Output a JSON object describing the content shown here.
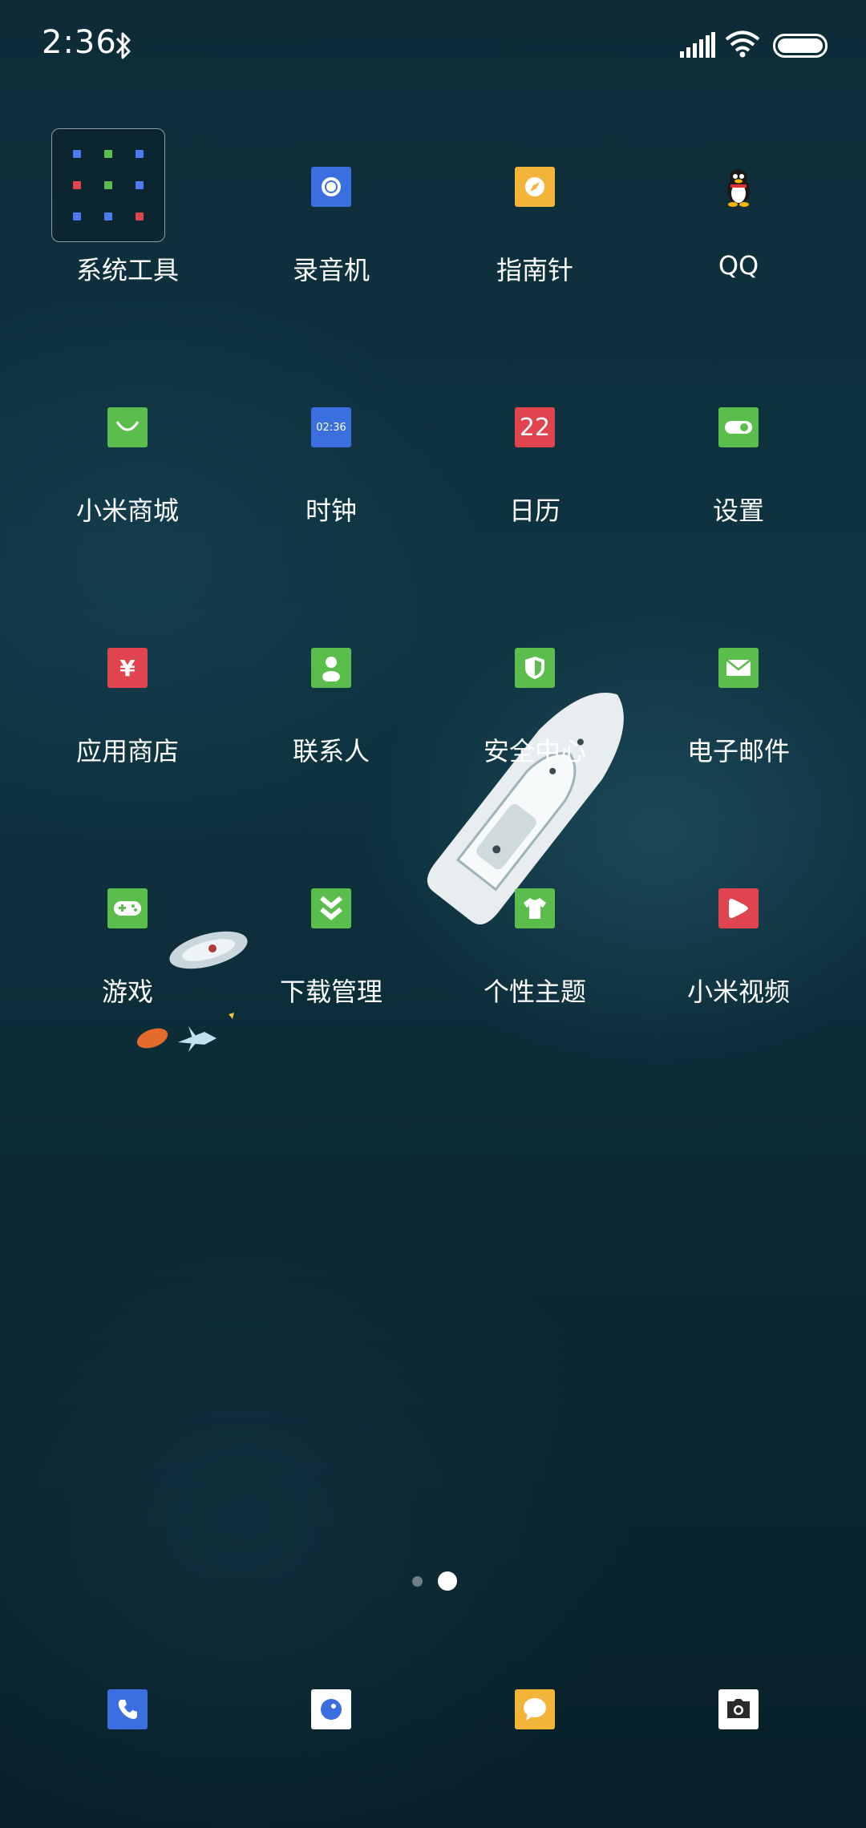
{
  "status": {
    "time": "2:36",
    "icons": [
      "bluetooth-icon",
      "signal-icon",
      "wifi-icon",
      "battery-icon"
    ]
  },
  "apps": [
    {
      "label": "系统工具",
      "icon": "folder-icon",
      "color": "#1a2d33"
    },
    {
      "label": "录音机",
      "icon": "recorder-icon",
      "color": "#3b6fe0"
    },
    {
      "label": "指南针",
      "icon": "compass-icon",
      "color": "#f3b43a"
    },
    {
      "label": "QQ",
      "icon": "qq-penguin-icon",
      "color": "#000000"
    },
    {
      "label": "小米商城",
      "icon": "shopping-bag-icon",
      "color": "#5bbd4c"
    },
    {
      "label": "时钟",
      "icon": "clock-icon",
      "color": "#3b6fe0",
      "tile_text": "02:36"
    },
    {
      "label": "日历",
      "icon": "calendar-icon",
      "color": "#e0454f",
      "tile_text": "22"
    },
    {
      "label": "设置",
      "icon": "settings-toggle-icon",
      "color": "#5bbd4c"
    },
    {
      "label": "应用商店",
      "icon": "yuan-icon",
      "color": "#e0454f",
      "tile_text": "¥"
    },
    {
      "label": "联系人",
      "icon": "person-icon",
      "color": "#5bbd4c"
    },
    {
      "label": "安全中心",
      "icon": "shield-icon",
      "color": "#5bbd4c"
    },
    {
      "label": "电子邮件",
      "icon": "envelope-icon",
      "color": "#5bbd4c"
    },
    {
      "label": "游戏",
      "icon": "gamepad-icon",
      "color": "#5bbd4c"
    },
    {
      "label": "下载管理",
      "icon": "download-icon",
      "color": "#5bbd4c"
    },
    {
      "label": "个性主题",
      "icon": "tshirt-icon",
      "color": "#5bbd4c"
    },
    {
      "label": "小米视频",
      "icon": "play-icon",
      "color": "#e0454f"
    }
  ],
  "folder_colors": [
    "#4a7bef",
    "#5bbd4c",
    "#4a7bef",
    "#e0454f",
    "#5bbd4c",
    "#4a7bef",
    "#4a7bef",
    "#4a7bef",
    "#e0454f"
  ],
  "page_indicator": {
    "pages": 2,
    "current": 2
  },
  "dock": [
    {
      "icon": "phone-icon",
      "color": "#3b6fe0"
    },
    {
      "icon": "browser-icon",
      "color": "#ffffff"
    },
    {
      "icon": "message-icon",
      "color": "#f3b43a"
    },
    {
      "icon": "camera-icon",
      "color": "#ffffff"
    }
  ]
}
